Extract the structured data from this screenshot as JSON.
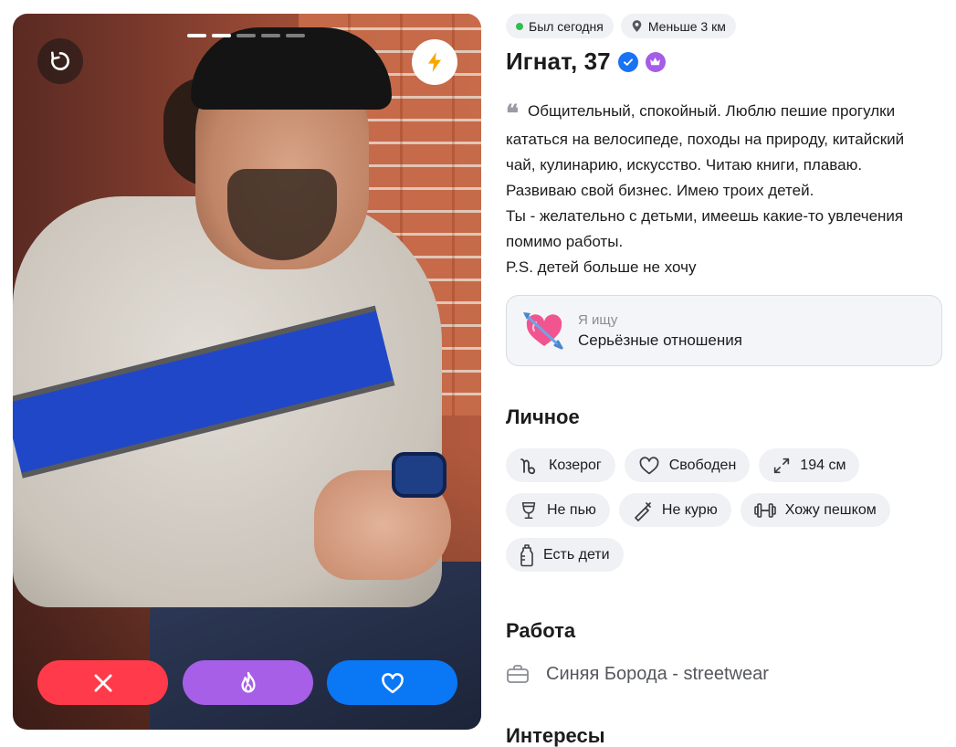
{
  "photo": {
    "progress_total": 5,
    "progress_active": 2
  },
  "status_chips": [
    {
      "label": "Был сегодня",
      "icon": "online-dot",
      "color": "#2fbf4f"
    },
    {
      "label": "Меньше 3 км",
      "icon": "location-pin-icon"
    }
  ],
  "profile": {
    "name_age": "Игнат, 37",
    "verified_icon": "verified-check-icon",
    "premium_icon": "crown-icon"
  },
  "about": {
    "lines": [
      "Общительный, спокойный. Люблю пешие прогулки",
      "кататься на велосипеде, походы на природу, китайский",
      "чай, кулинарию, искусство. Читаю книги, плаваю.",
      "Развиваю свой бизнес. Имею троих детей.",
      "Ты - желательно с детьми, имеешь какие-то увлечения",
      "помимо работы.",
      "P.S. детей больше не хочу"
    ]
  },
  "looking_for": {
    "label": "Я ищу",
    "value": "Серьёзные отношения"
  },
  "personal": {
    "title": "Личное",
    "tags": [
      {
        "label": "Козерог",
        "icon": "capricorn-icon"
      },
      {
        "label": "Свободен",
        "icon": "heart-outline-icon"
      },
      {
        "label": "194 см",
        "icon": "height-arrows-icon"
      },
      {
        "label": "Не пью",
        "icon": "wine-glass-icon"
      },
      {
        "label": "Не курю",
        "icon": "no-smoking-icon"
      },
      {
        "label": "Хожу пешком",
        "icon": "dumbbell-icon"
      },
      {
        "label": "Есть дети",
        "icon": "baby-bottle-icon"
      }
    ]
  },
  "work": {
    "title": "Работа",
    "value": "Синяя Борода - streetwear"
  },
  "interests": {
    "title": "Интересы"
  },
  "colors": {
    "dislike": "#ff3b4b",
    "superlike": "#a65fe6",
    "like": "#0a77f5",
    "boost": "#f6a800"
  }
}
